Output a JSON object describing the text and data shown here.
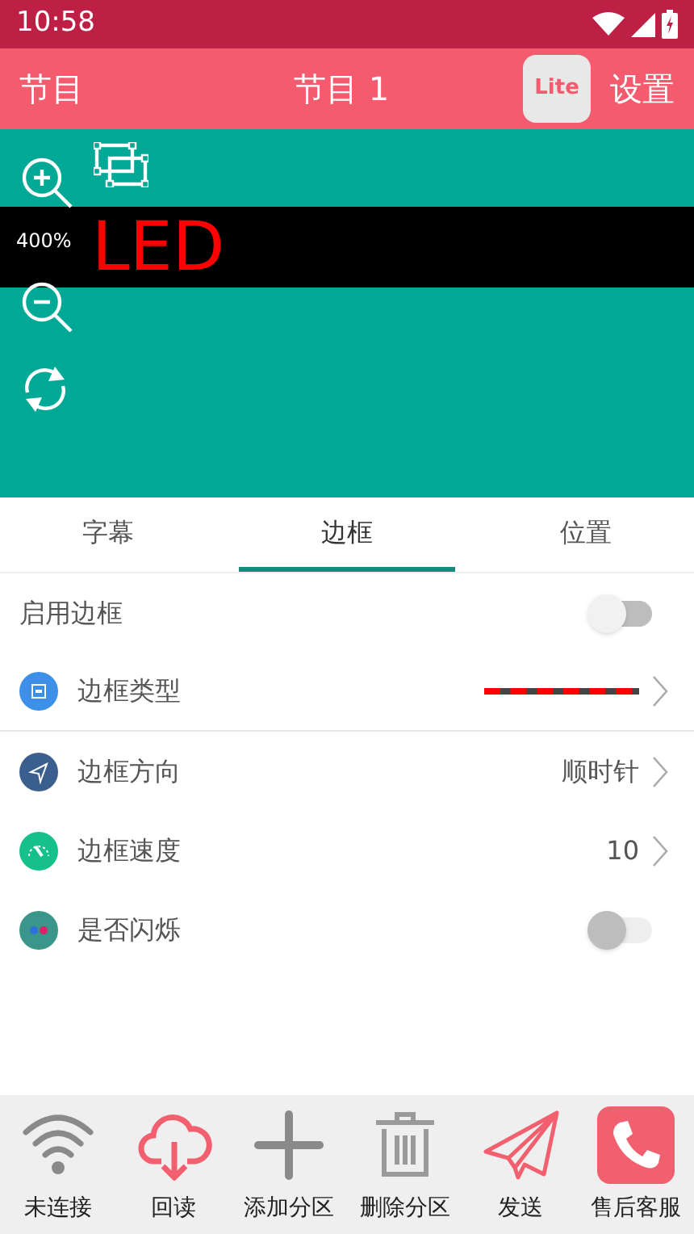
{
  "status_bar": {
    "time": "10:58"
  },
  "header": {
    "left": "节目",
    "title": "节目 1",
    "badge": "Lite",
    "right": "设置"
  },
  "preview": {
    "zoom": "400%",
    "text": "LED"
  },
  "tabs": [
    {
      "label": "字幕",
      "selected": false
    },
    {
      "label": "边框",
      "selected": true
    },
    {
      "label": "位置",
      "selected": false
    }
  ],
  "settings": [
    {
      "kind": "toggle",
      "label": "启用边框",
      "on": false,
      "disabled": false
    },
    {
      "kind": "pattern",
      "label": "边框类型"
    },
    {
      "kind": "value",
      "label": "边框方向",
      "value": "顺时针"
    },
    {
      "kind": "value",
      "label": "边框速度",
      "value": "10"
    },
    {
      "kind": "toggle",
      "label": "是否闪烁",
      "on": false,
      "disabled": true
    }
  ],
  "bottom_nav": [
    {
      "label": "未连接"
    },
    {
      "label": "回读"
    },
    {
      "label": "添加分区"
    },
    {
      "label": "删除分区"
    },
    {
      "label": "发送"
    },
    {
      "label": "售后客服"
    }
  ]
}
